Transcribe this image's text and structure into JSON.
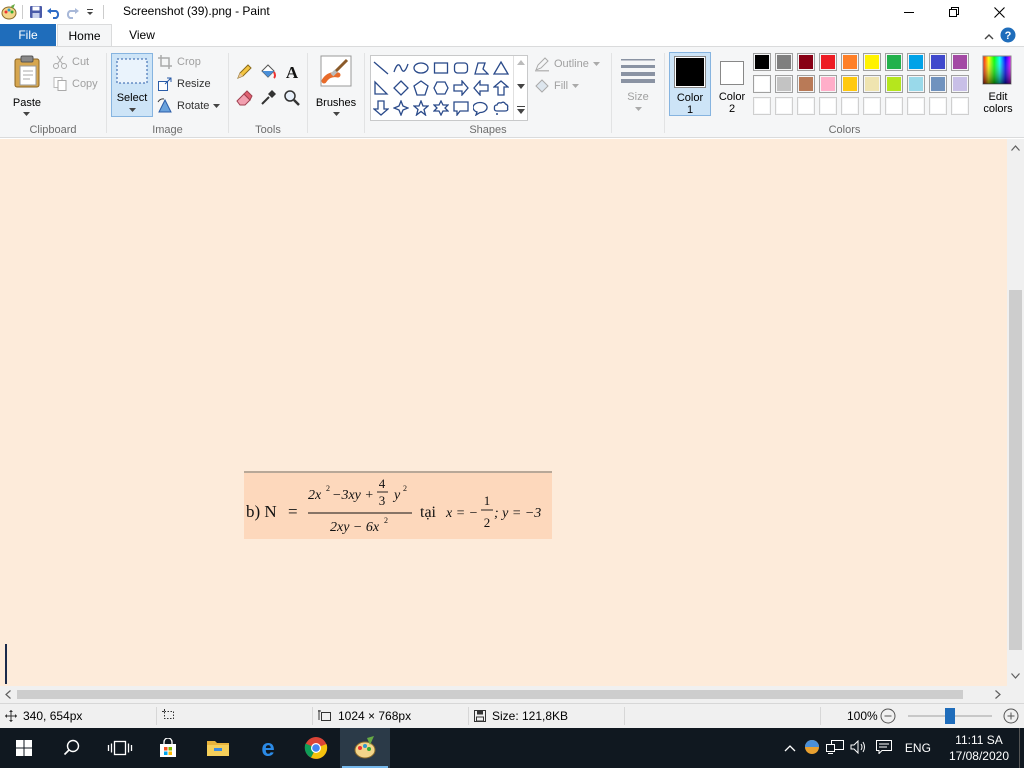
{
  "window": {
    "title": "Screenshot (39).png - Paint",
    "minimize": "minimize-icon",
    "maximize": "restore-icon",
    "close": "close-icon"
  },
  "tabs": {
    "file": "File",
    "home": "Home",
    "view": "View"
  },
  "ribbon": {
    "clipboard": {
      "label": "Clipboard",
      "paste": "Paste",
      "cut": "Cut",
      "copy": "Copy"
    },
    "image": {
      "label": "Image",
      "select": "Select",
      "crop": "Crop",
      "resize": "Resize",
      "rotate": "Rotate"
    },
    "tools": {
      "label": "Tools"
    },
    "brushes": {
      "label": "Brushes"
    },
    "shapes": {
      "label": "Shapes",
      "outline": "Outline",
      "fill": "Fill"
    },
    "size": {
      "label": "Size"
    },
    "colors": {
      "label": "Colors",
      "color1": "Color",
      "color1_num": "1",
      "color2": "Color",
      "color2_num": "2",
      "edit": "Edit",
      "edit2": "colors",
      "color1_value": "#000000",
      "color2_value": "#ffffff",
      "row1": [
        "#000000",
        "#7f7f7f",
        "#880015",
        "#ed1c24",
        "#ff7f27",
        "#fff200",
        "#22b14c",
        "#00a2e8",
        "#3f48cc",
        "#a349a4"
      ],
      "row2": [
        "#ffffff",
        "#c3c3c3",
        "#b97a57",
        "#ffaec9",
        "#ffc90e",
        "#efe4b0",
        "#b5e61d",
        "#99d9ea",
        "#7092be",
        "#c8bfe7"
      ],
      "row3": [
        "#ffffff",
        "#ffffff",
        "#ffffff",
        "#ffffff",
        "#ffffff",
        "#ffffff",
        "#ffffff",
        "#ffffff",
        "#ffffff",
        "#ffffff"
      ]
    }
  },
  "canvas": {
    "background": "#fdebda",
    "image": {
      "prefix": "b) N",
      "equals": "=",
      "num_a": "2x",
      "num_a_exp": "2",
      "num_b": "−3xy +",
      "frac_num": "4",
      "frac_den": "3",
      "num_c": "y",
      "num_c_exp": "2",
      "den": "2xy − 6x",
      "den_exp": "2",
      "tai": "tại",
      "x_eq": "x = −",
      "half_num": "1",
      "half_den": "2",
      "y_eq": "; y = −3"
    }
  },
  "status": {
    "cursor": "340, 654px",
    "dimensions": "1024 × 768px",
    "size": "Size: 121,8KB",
    "zoom": "100%"
  },
  "taskbar": {
    "language": "ENG",
    "time": "11:11 SA",
    "date": "17/08/2020"
  }
}
